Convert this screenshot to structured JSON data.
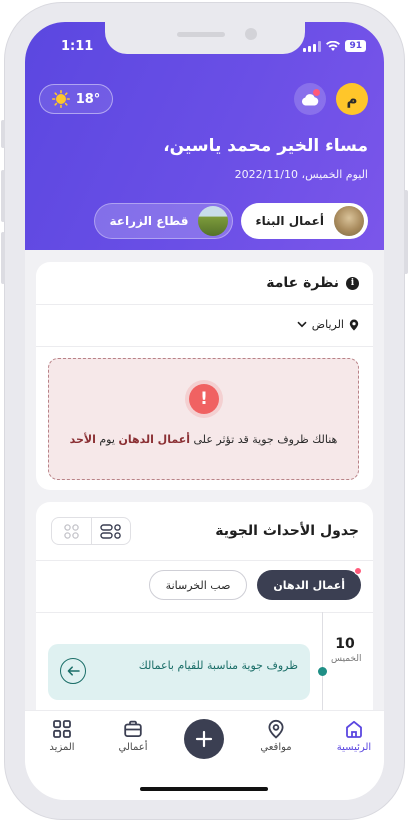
{
  "status_bar": {
    "time": "1:11",
    "battery": "91"
  },
  "weather": {
    "temperature": "18°",
    "icon": "sun-icon"
  },
  "header": {
    "avatar_initial": "م",
    "greeting": "مساء الخير محمد ياسين،",
    "date": "اليوم الخميس، 2022/11/10"
  },
  "sectors": [
    {
      "label": "أعمال البناء",
      "active": true
    },
    {
      "label": "قطاع الزراعة",
      "active": false
    }
  ],
  "overview": {
    "title": "نظرة عامة",
    "location": "الرياض",
    "alert": {
      "text_before": "هنالك ظروف جوية قد تؤثر على",
      "highlight_activity": "أعمال الدهان",
      "text_middle": "يوم",
      "highlight_day": "الأحد"
    }
  },
  "schedule": {
    "title": "جدول الأحداث الجوية",
    "tabs": [
      {
        "label": "أعمال الدهان",
        "active": true
      },
      {
        "label": "صب الخرسانة",
        "active": false
      }
    ],
    "events": [
      {
        "date_num": "10",
        "day": "الخميس",
        "text": "ظروف جوية مناسبة للقيام باعمالك"
      }
    ]
  },
  "bottom_nav": {
    "home": "الرئيسية",
    "locations": "مواقعي",
    "works": "أعمالي",
    "more": "المزيد"
  },
  "colors": {
    "header_gradient_start": "#5b47e0",
    "accent": "#5b47e0",
    "alert_bg": "#f6e8e9",
    "alert_icon": "#f06262",
    "event_bg": "#dff1f1",
    "dark": "#3b3f52"
  }
}
